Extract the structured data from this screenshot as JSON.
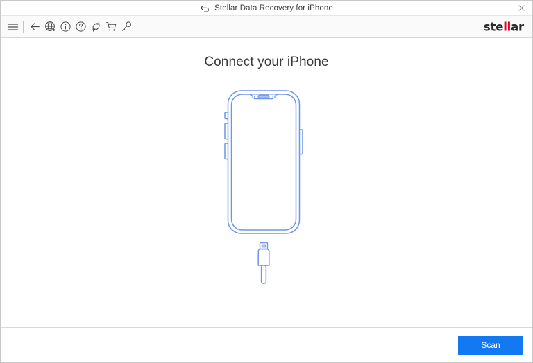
{
  "window": {
    "title": "Stellar Data Recovery for iPhone",
    "title_icon": "back-arrow-icon",
    "controls": [
      {
        "name": "minimize-button",
        "glyph": "minimize-icon"
      },
      {
        "name": "close-button",
        "glyph": "close-icon"
      }
    ]
  },
  "toolbar": {
    "items": [
      {
        "name": "menu-button",
        "icon": "hamburger-menu-icon"
      },
      {
        "name": "back-button",
        "icon": "arrow-left-icon"
      },
      {
        "name": "globe-button",
        "icon": "globe-icon"
      },
      {
        "name": "info-button",
        "icon": "info-circle-icon"
      },
      {
        "name": "help-button",
        "icon": "question-circle-icon"
      },
      {
        "name": "refresh-button",
        "icon": "refresh-icon"
      },
      {
        "name": "cart-button",
        "icon": "shopping-cart-icon"
      },
      {
        "name": "activate-button",
        "icon": "key-icon"
      }
    ],
    "brand": {
      "prefix": "ste",
      "highlight": "ll",
      "suffix": "ar",
      "highlight_color": "#e2001a"
    }
  },
  "main": {
    "heading": "Connect your iPhone",
    "illustration": {
      "name": "iphone-with-lightning-cable-illustration",
      "stroke_color": "#6d95e8",
      "fill_color": "#ffffff",
      "parts": [
        "phone-outer-frame",
        "phone-inner-screen",
        "notch",
        "earpiece-speaker",
        "front-camera-dot-left",
        "front-camera-dot-right",
        "mute-switch",
        "volume-up-button",
        "volume-down-button",
        "power-button",
        "lightning-connector-tip",
        "lightning-connector-body",
        "lightning-cable"
      ]
    }
  },
  "footer": {
    "scan_label": "Scan",
    "scan_color": "#1279f2"
  }
}
